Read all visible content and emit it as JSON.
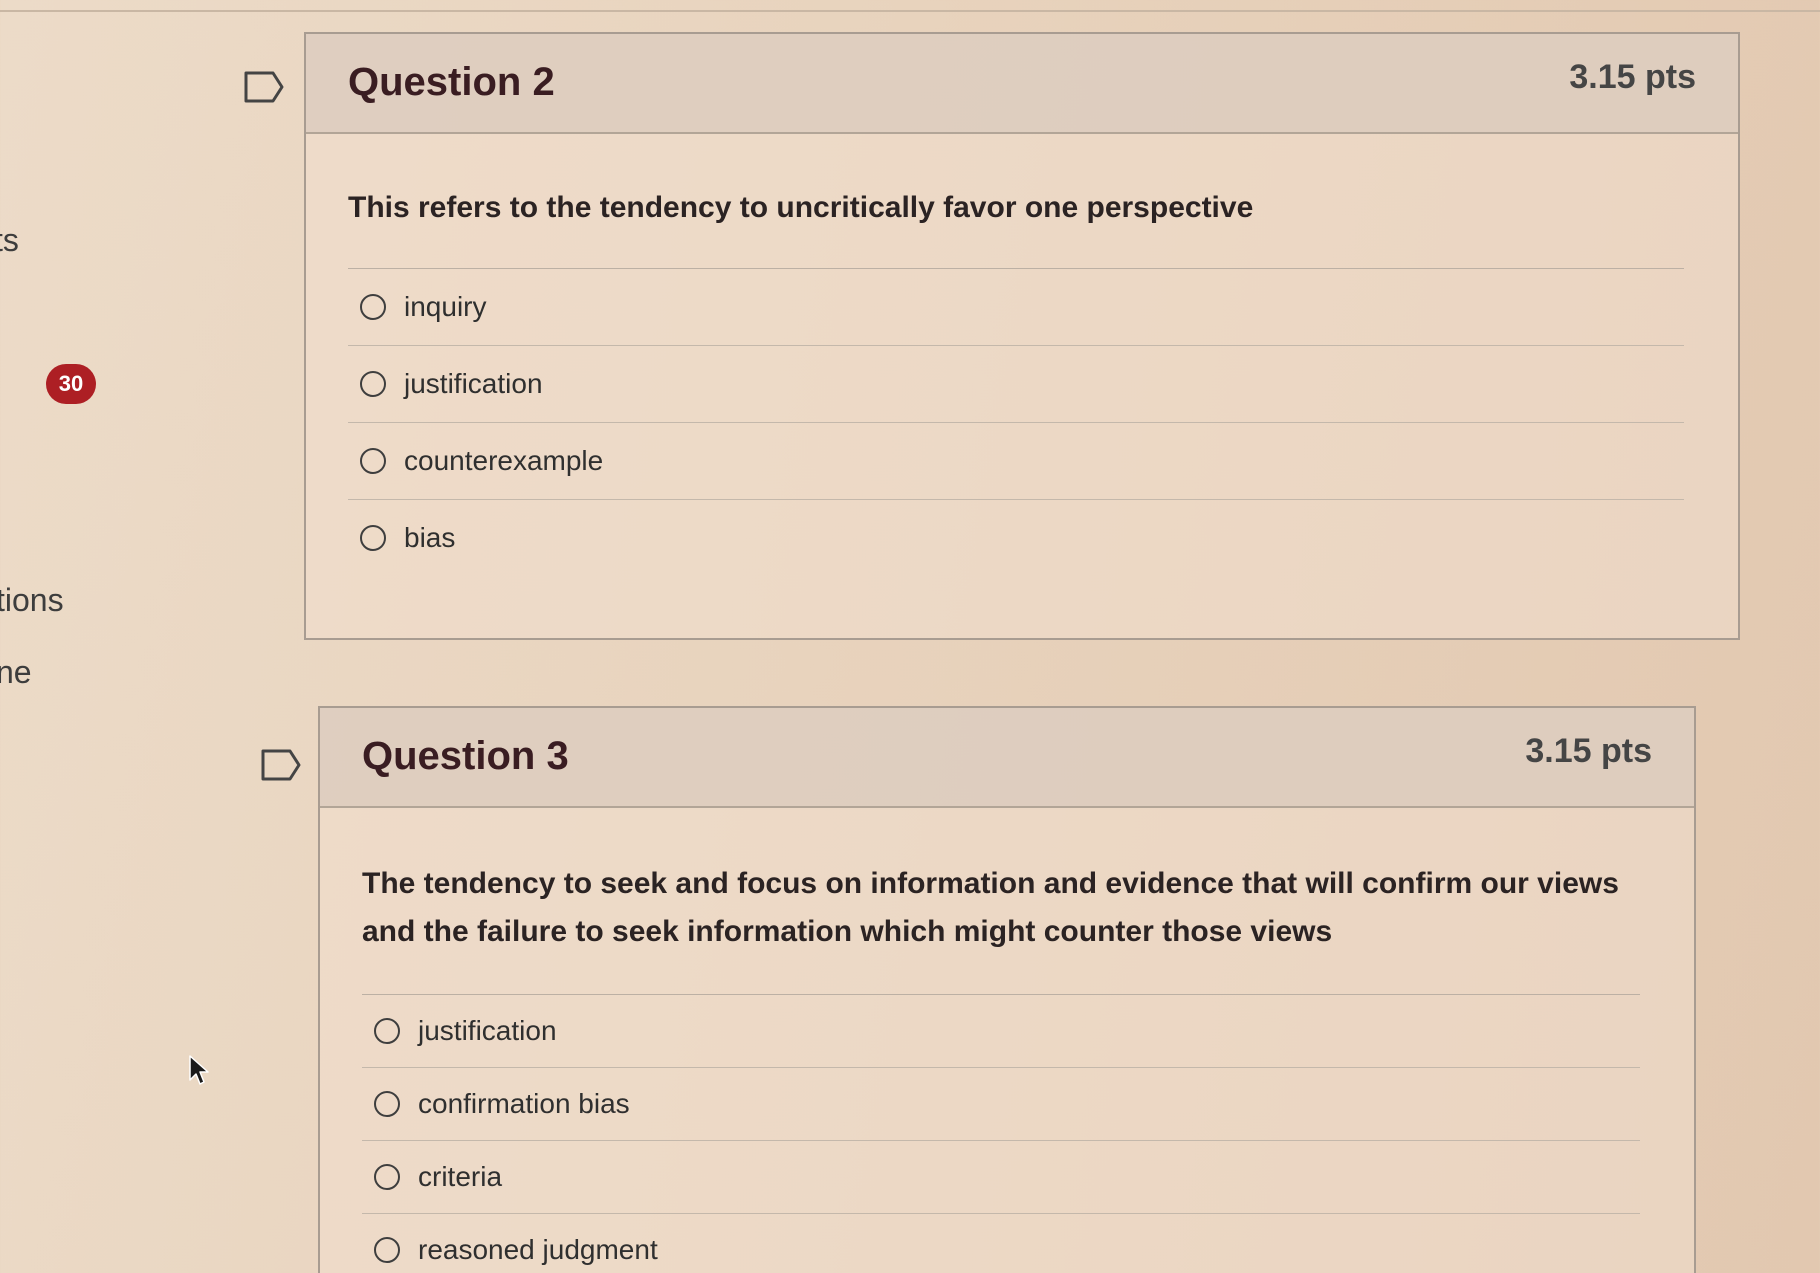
{
  "sidebar": {
    "fragment_1": "ts",
    "badge_count": "30",
    "fragment_2": "tions",
    "fragment_3": "ne"
  },
  "questions": [
    {
      "title": "Question 2",
      "points": "3.15 pts",
      "text": "This refers to the tendency to uncritically favor one perspective",
      "answers": [
        "inquiry",
        "justification",
        "counterexample",
        "bias"
      ]
    },
    {
      "title": "Question 3",
      "points": "3.15 pts",
      "text": "The tendency to seek and focus on information and evidence that will confirm our views and the failure to seek information which might counter those views",
      "answers": [
        "justification",
        "confirmation bias",
        "criteria",
        "reasoned judgment"
      ]
    }
  ],
  "icons": {
    "flag": "flag-outline-icon",
    "cursor": "mouse-pointer-icon"
  },
  "colors": {
    "badge": "#ad1f24",
    "title": "#3a1d22"
  }
}
